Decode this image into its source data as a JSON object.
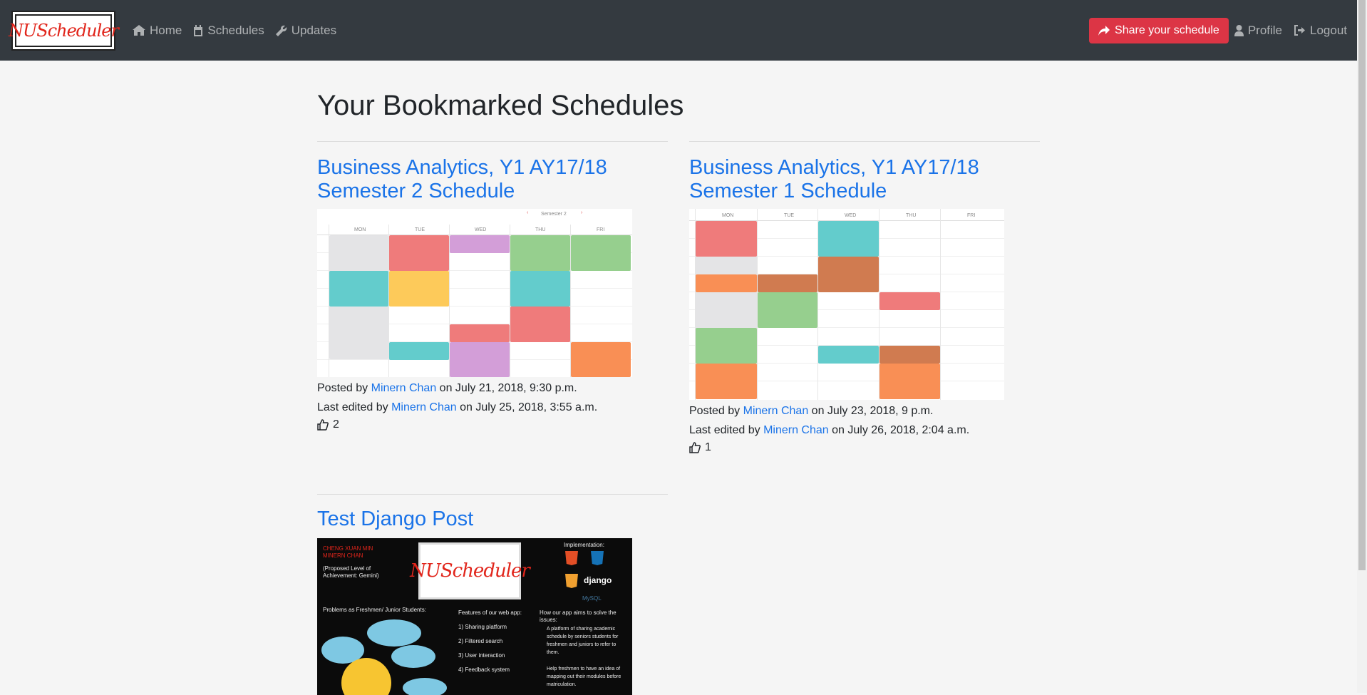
{
  "nav": {
    "brand": "NUScheduler",
    "links": [
      {
        "label": "Home",
        "icon": "home-icon"
      },
      {
        "label": "Schedules",
        "icon": "calendar-icon"
      },
      {
        "label": "Updates",
        "icon": "wrench-icon"
      }
    ],
    "share_label": "Share your schedule",
    "profile_label": "Profile",
    "logout_label": "Logout"
  },
  "page": {
    "title": "Your Bookmarked Schedules"
  },
  "posts": [
    {
      "title": "Business Analytics, Y1 AY17/18 Semester 2 Schedule",
      "posted_prefix": "Posted by",
      "author": "Minern Chan",
      "posted_date": "on July 21, 2018, 9:30 p.m.",
      "edited_prefix": "Last edited by",
      "editor": "Minern Chan",
      "edited_date": "on July 25, 2018, 3:55 a.m.",
      "likes": "2",
      "thumbnail_label": "Semester 2",
      "days": [
        "MON",
        "TUE",
        "WED",
        "THU",
        "FRI"
      ]
    },
    {
      "title": "Business Analytics, Y1 AY17/18 Semester 1 Schedule",
      "posted_prefix": "Posted by",
      "author": "Minern Chan",
      "posted_date": "on July 23, 2018, 9 p.m.",
      "edited_prefix": "Last edited by",
      "editor": "Minern Chan",
      "edited_date": "on July 26, 2018, 2:04 a.m.",
      "likes": "1",
      "days": [
        "MON",
        "TUE",
        "WED",
        "THU",
        "FRI"
      ]
    },
    {
      "title": "Test Django Post",
      "poster": {
        "authors": "CHENG XUAN MIN\nMINERN CHAN",
        "level": "(Proposed Level of Achievement: Gemini)",
        "logo": "NUScheduler",
        "implementation": "Implementation:",
        "problems": "Problems as Freshmen/ Junior Students:",
        "features_title": "Features of our web app:",
        "features": [
          "1)  Sharing platform",
          "2)  Filtered search",
          "3)  User interaction",
          "4)  Feedback system"
        ],
        "aims_title": "How our app aims to solve the issues:",
        "aims": [
          "A platform of sharing academic schedule by seniors students for freshmen and juniors to refer to them.",
          "Help freshmen to have an idea of mapping out their modules before matriculation."
        ]
      }
    }
  ],
  "colors": {
    "navbar": "#343a40",
    "share_button": "#dc3545",
    "link": "#1a73e8",
    "page_bg": "#f5f5f5"
  }
}
